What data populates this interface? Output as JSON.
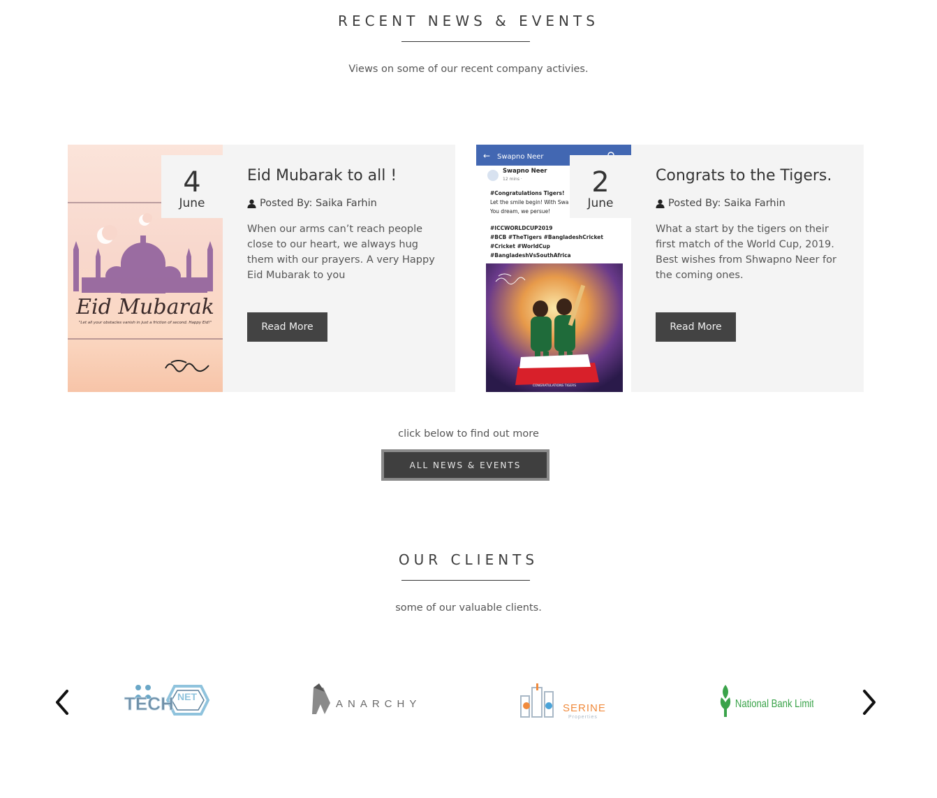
{
  "news_section": {
    "title": "RECENT NEWS & EVENTS",
    "subtitle": "Views on some of our recent company activies."
  },
  "news": [
    {
      "day": "4",
      "month": "June",
      "title": "Eid Mubarak to all !",
      "posted_by": "Posted By: Saika Farhin",
      "excerpt": "When our arms can’t reach people close to our heart, we always hug them with our prayers. A very Happy Eid Mubarak to you",
      "button": "Read More",
      "image_text": {
        "headline": "Eid Mubarak",
        "tagline": "\"Let all your obstacles vanish in just a friction of second. Happy Eid!\""
      }
    },
    {
      "day": "2",
      "month": "June",
      "title": "Congrats to the Tigers.",
      "posted_by": "Posted By: Saika Farhin",
      "excerpt": "What a start by the tigers on their first match of the World Cup, 2019. Best wishes from Shwapno Neer for the coming ones.",
      "button": "Read More",
      "image_text": {
        "app_bar": "Swapno Neer",
        "page_name": "Swapno Neer",
        "time": "12 mins ·",
        "line1": "#Congratulations Tigers!",
        "line2": "Let the smile begin! With Swa",
        "line3": "You dream, we persue!",
        "tags": [
          "#ICCWORLDCUP2019",
          "#BCB #TheTigers #BangladeshCricket",
          "#Cricket #WorldCup",
          "#BangladeshVsSouthAfrica"
        ],
        "banner_sub": "CONGRATULATIONS TIGERS"
      }
    }
  ],
  "cta": {
    "text": "click below to find out more",
    "button": "ALL NEWS & EVENTS"
  },
  "clients_section": {
    "title": "OUR CLIENTS",
    "subtitle": "some of our valuable clients."
  },
  "clients": [
    {
      "name": "TECHNET",
      "part1": "TECH",
      "part2": "NET"
    },
    {
      "name": "ANARCHY"
    },
    {
      "name": "SERINE",
      "sub": "Properties"
    },
    {
      "name": "National Bank Limited"
    }
  ],
  "colors": {
    "button_dark": "#434343",
    "card_bg": "#f4f4f4",
    "eid_purple": "#8a5a9a",
    "tigers_green": "#1f6b3a",
    "bank_green": "#3aa34a",
    "serine_orange": "#f08a3c"
  }
}
